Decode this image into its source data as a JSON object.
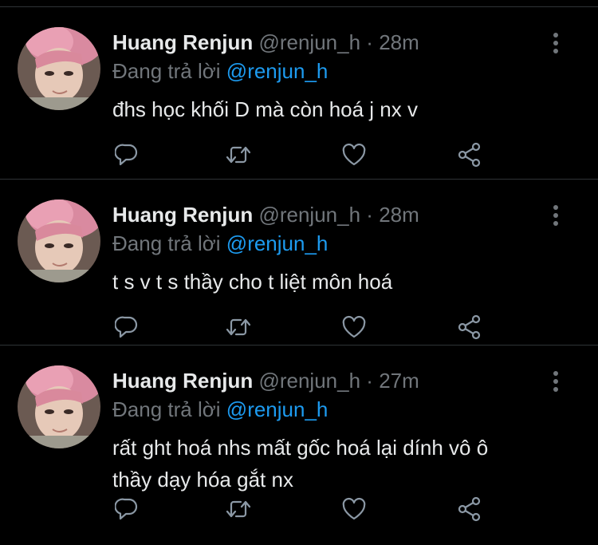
{
  "colors": {
    "background": "#000000",
    "divider": "#2f3336",
    "text": "#e7e9ea",
    "muted": "#71767b",
    "mention": "#1d9bf0"
  },
  "tweets": [
    {
      "name": "Huang Renjun",
      "handle": "@renjun_h",
      "dot": "·",
      "time": "28m",
      "reply_prefix": "Đang trả lời",
      "reply_to": "@renjun_h",
      "text": "đhs học khối D mà còn hoá j nx v",
      "icons": [
        "reply-icon",
        "retweet-icon",
        "like-icon",
        "share-icon"
      ]
    },
    {
      "name": "Huang Renjun",
      "handle": "@renjun_h",
      "dot": "·",
      "time": "28m",
      "reply_prefix": "Đang trả lời",
      "reply_to": "@renjun_h",
      "text": "t s v t s thầy cho t liệt môn hoá",
      "icons": [
        "reply-icon",
        "retweet-icon",
        "like-icon",
        "share-icon"
      ]
    },
    {
      "name": "Huang Renjun",
      "handle": "@renjun_h",
      "dot": "·",
      "time": "27m",
      "reply_prefix": "Đang trả lời",
      "reply_to": "@renjun_h",
      "text_line1": "rất ght hoá nhs mất gốc hoá lại dính vô ô",
      "text_line2": "thầy dạy hóa gắt nx",
      "icons": [
        "reply-icon",
        "retweet-icon",
        "like-icon",
        "share-icon"
      ]
    }
  ]
}
